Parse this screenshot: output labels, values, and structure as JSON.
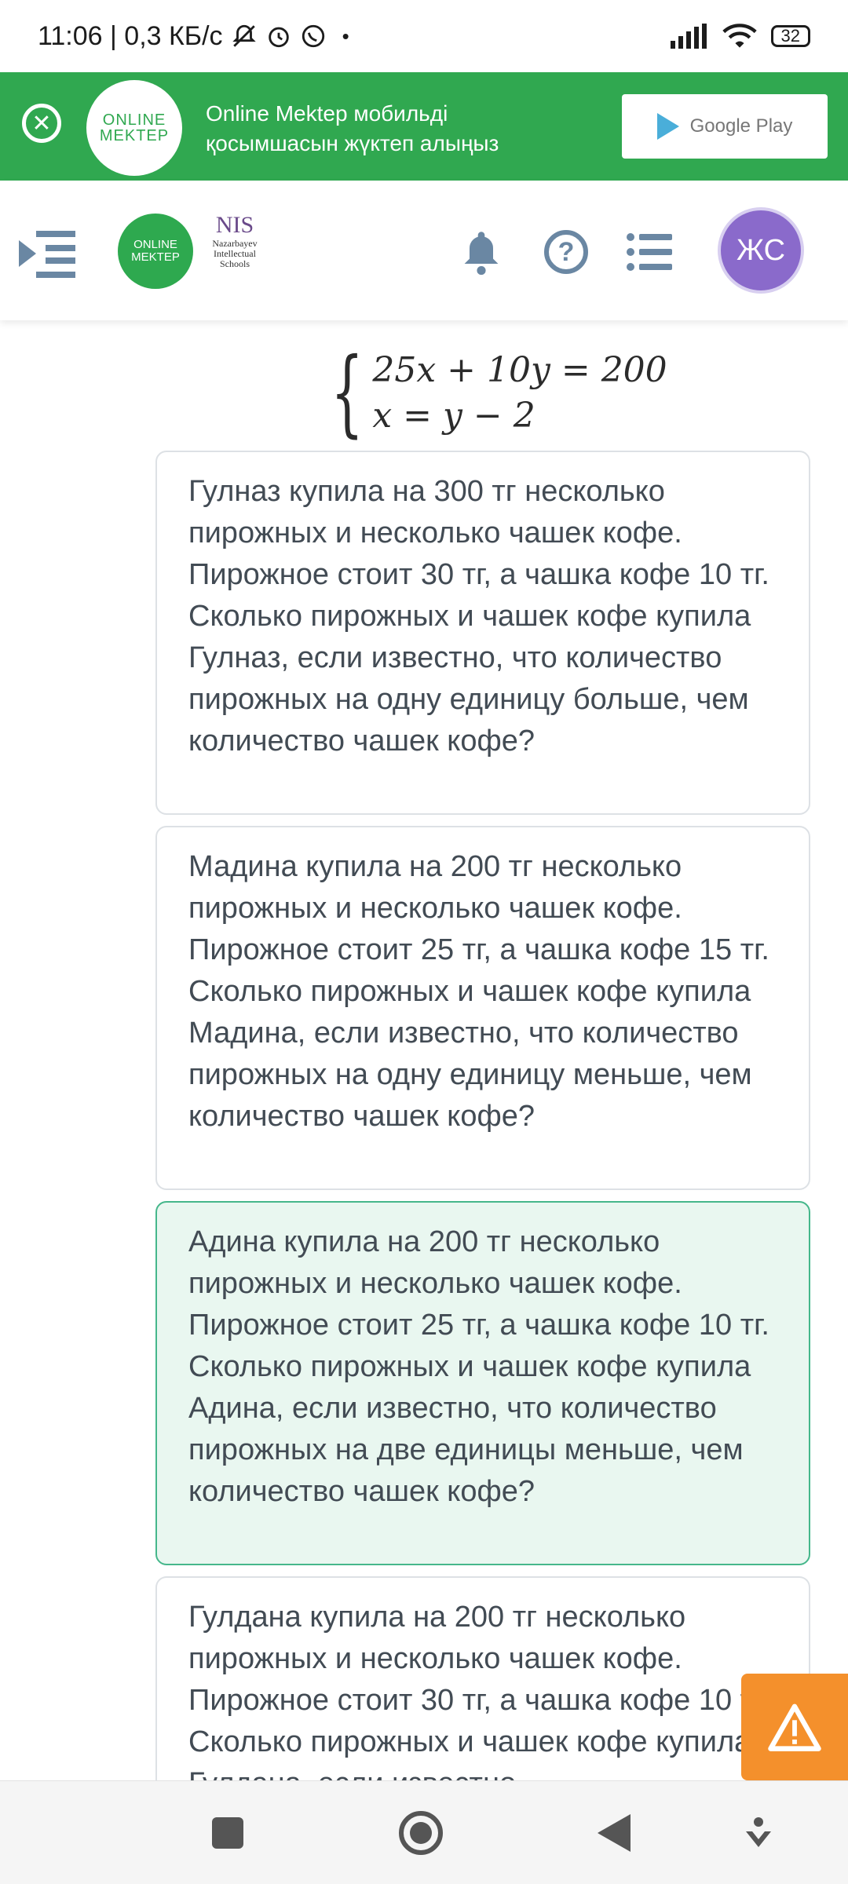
{
  "status_bar": {
    "left_text": "11:06 | 0,3 КБ/с",
    "battery": "32"
  },
  "banner": {
    "logo_line1": "ONLINE",
    "logo_line2": "MEKTEP",
    "text_line1": "Online Mektep мобильді",
    "text_line2": "қосымшасын жүктеп алыңыз",
    "store_label": "Google Play"
  },
  "header": {
    "logo_line1": "ONLINE",
    "logo_line2": "MEKTEP",
    "nis_mark": "NIS",
    "nis_sub1": "Nazarbayev",
    "nis_sub2": "Intellectual",
    "nis_sub3": "Schools",
    "avatar_initials": "ЖС"
  },
  "equation": {
    "line1": "25x + 10y = 200",
    "line2": "x = y − 2"
  },
  "options": [
    {
      "text": "Гулназ купила на 300 тг несколько пирожных и несколько чашек кофе. Пирожное стоит 30 тг, а чашка кофе 10 тг. Сколько пирожных и чашек кофе купила Гулназ, если известно, что количество пирожных на одну единицу больше, чем количество чашек кофе?",
      "selected": false
    },
    {
      "text": "Мадина купила на 200 тг несколько пирожных и несколько чашек кофе. Пирожное стоит 25 тг, а чашка кофе 15 тг. Сколько пирожных и чашек кофе купила Мадина, если известно, что количество пирожных на одну единицу меньше, чем количество чашек кофе?",
      "selected": false
    },
    {
      "text": "Адина купила на 200 тг несколько пирожных и несколько чашек кофе. Пирожное стоит 25 тг, а чашка кофе 10 тг. Сколько пирожных и чашек кофе купила Адина, если известно, что количество пирожных на две единицы меньше, чем количество чашек кофе?",
      "selected": true
    },
    {
      "text": "Гулдана купила на 200 тг несколько пирожных и несколько чашек кофе. Пирожное стоит 30 тг, а чашка кофе 10 тг. Сколько пирожных и чашек кофе купила Гулдана, если известно",
      "selected": false
    }
  ],
  "colors": {
    "banner_green": "#30a850",
    "selected_bg": "#e9f7f0",
    "selected_border": "#45b78b",
    "report_orange": "#f4902c",
    "avatar_purple": "#8a6acb",
    "icon_gray_blue": "#6a87a3"
  }
}
